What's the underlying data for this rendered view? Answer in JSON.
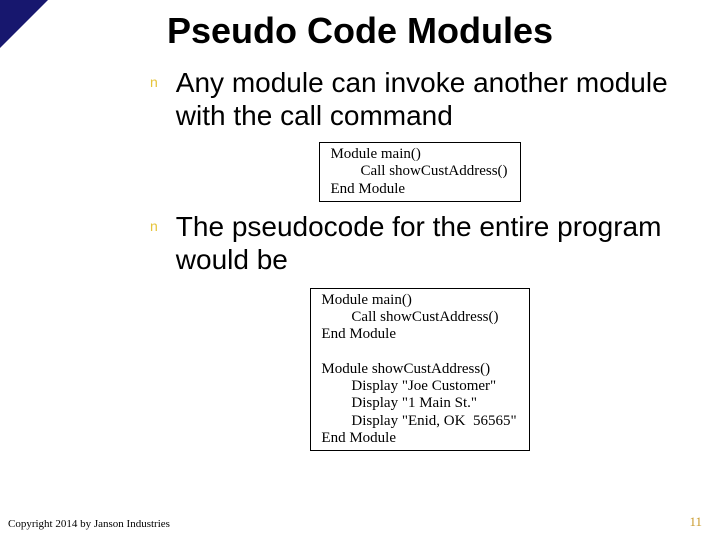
{
  "title": "Pseudo Code Modules",
  "bullets": [
    "Any module can invoke another module with the call command",
    "The pseudocode for the entire program would be"
  ],
  "bullet_glyph": "n",
  "code_box_1": "Module main()\n        Call showCustAddress()\nEnd Module",
  "code_box_2": "Module main()\n        Call showCustAddress()\nEnd Module\n\nModule showCustAddress()\n        Display \"Joe Customer\"\n        Display \"1 Main St.\"\n        Display \"Enid, OK  56565\"\nEnd Module",
  "copyright": "Copyright 2014 by Janson Industries",
  "slide_number": "11"
}
